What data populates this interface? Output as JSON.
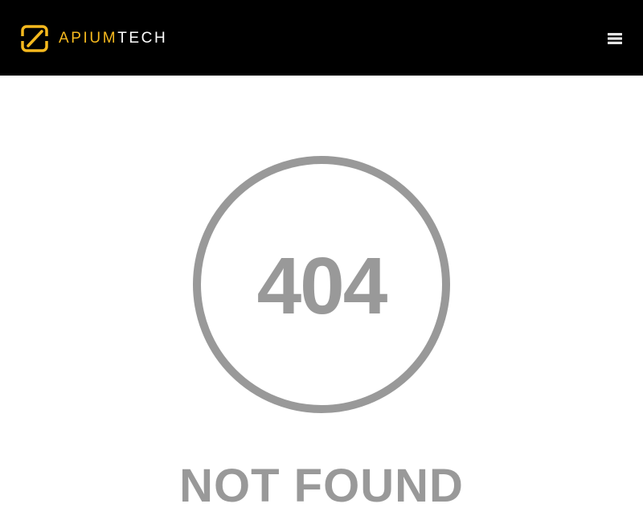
{
  "header": {
    "brand_part1": "APIUM",
    "brand_part2": "TECH",
    "logo_icon": "apiumtech-logo-icon",
    "menu_icon": "hamburger-menu-icon"
  },
  "error": {
    "code": "404",
    "message": "NOT FOUND"
  },
  "colors": {
    "header_bg": "#000000",
    "brand_accent": "#f6b91e",
    "brand_white": "#ffffff",
    "error_grey": "#999999",
    "page_bg": "#ffffff"
  }
}
